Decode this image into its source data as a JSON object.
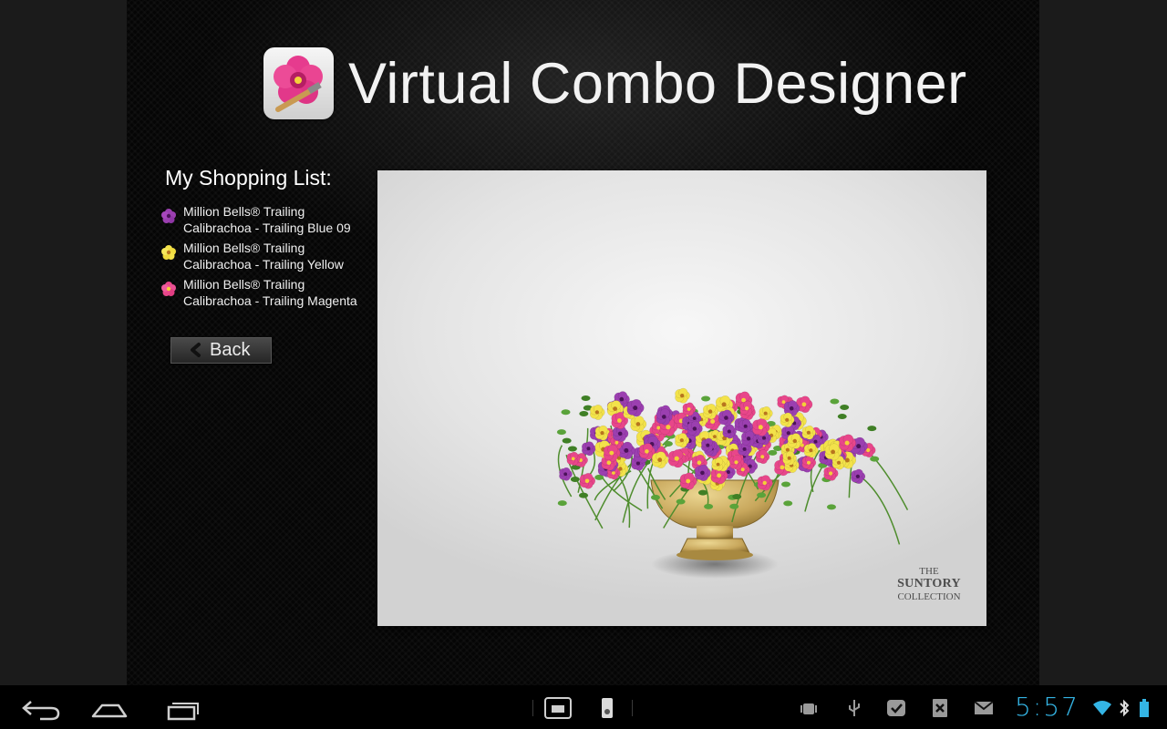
{
  "app": {
    "title": "Virtual Combo Designer",
    "icon": "petunia-paintbrush-icon"
  },
  "shopping_list": {
    "heading": "My Shopping List:",
    "items": [
      {
        "line1": "Million Bells® Trailing",
        "line2": "Calibrachoa - Trailing Blue 09",
        "icon": "purple-flower-icon",
        "color": "#9b3fb0"
      },
      {
        "line1": "Million Bells® Trailing",
        "line2": "Calibrachoa - Trailing Yellow",
        "icon": "yellow-flower-icon",
        "color": "#f3e24a"
      },
      {
        "line1": "Million Bells® Trailing",
        "line2": "Calibrachoa - Trailing Magenta",
        "icon": "magenta-flower-icon",
        "color": "#e8468a"
      }
    ]
  },
  "back_button": {
    "label": "Back",
    "icon": "chevron-left-icon"
  },
  "preview": {
    "brand_line1": "THE",
    "brand_line2": "SUNTORY",
    "brand_line3": "COLLECTION",
    "image": "flower-urn-arrangement"
  },
  "status_bar": {
    "time": "5:57",
    "accent": "#34b5e5",
    "icons": [
      "android-debug-icon",
      "usb-icon",
      "checkmark-icon",
      "close-x-icon",
      "gmail-icon",
      "wifi-icon",
      "bluetooth-icon",
      "battery-icon"
    ]
  },
  "nav": {
    "buttons": [
      "back-icon",
      "home-icon",
      "recent-apps-icon"
    ],
    "center_icons": [
      "screenshot-icon",
      "sd-card-icon"
    ]
  }
}
